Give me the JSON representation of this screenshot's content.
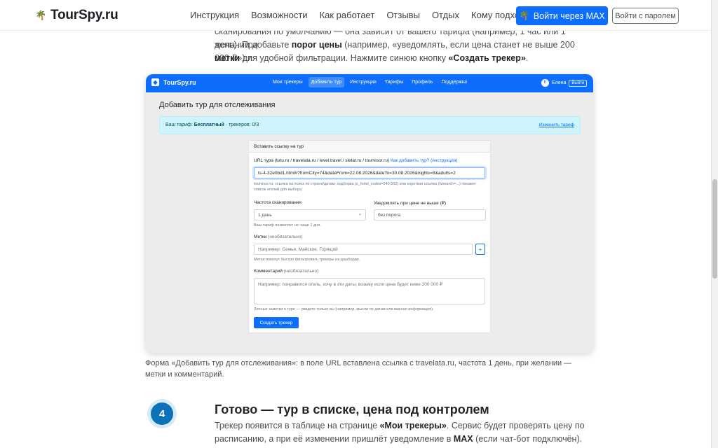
{
  "site": {
    "logo_icon": "palm-tree-icon",
    "logo_text": "TourSpy.ru",
    "nav": [
      "Инструкция",
      "Возможности",
      "Как работает",
      "Отзывы",
      "Отдых",
      "Кому подходит"
    ],
    "btn_max": "Войти через MAX",
    "btn_max_icon": "🌴",
    "btn_password": "Войти с паролем",
    "accent": "#0d6efd"
  },
  "intro": {
    "line1": "сканирования по умолчанию — она зависит от вашего тарифа (например, 1 час или 1 день). При",
    "line2_a": "желании добавьте ",
    "line2_b": "порог цены",
    "line2_c": " (например, «уведомлять, если цена станет не выше 200 000 ₽») и",
    "line3_a": "метки",
    "line3_b": " для удобной фильтрации. Нажмите синюю кнопку ",
    "line3_c": "«Создать трекер»",
    "line3_d": "."
  },
  "shot": {
    "logo_text": "TourSpy.ru",
    "nav": [
      "Мои трекеры",
      "Добавить тур",
      "Инструкция",
      "Тарифы",
      "Профиль",
      "Поддержка"
    ],
    "active_nav": 1,
    "user_initial": "Е",
    "user_name": "Елена",
    "logout": "Выйти",
    "title": "Добавить тур для отслеживания",
    "tariff_prefix": "Ваш тариф: ",
    "tariff_name": "Бесплатный",
    "tariff_suffix": " · трекеров: 0/3",
    "tariff_link": "Изменить тариф",
    "form_header": "Вставить ссылку на тур",
    "url_label": "URL тура (tutu.ru / travelata.ru / level.travel / sletat.ru / tourvisor.ru)",
    "url_help_link": "Как добавить тур? (инструкция)",
    "url_value": "ts-4-32e0bd1.html#?fromCity=74&dateFrom=22.08.2026&dateTo=30.08.2026&nights=8&adults=2",
    "url_hint": "tourvisor.ru: ссылка на поиск по стране/датам, подборка (s_hotel_codes=240,502) или короткая ссылка (tvsearch=...) покажет список отелей для выбора.",
    "freq_label": "Частота сканирования",
    "freq_value": "1 день",
    "freq_hint": "Ваш тариф позволяет не чаще 1 дня.",
    "threshold_label": "Уведомлять при цене не выше (₽)",
    "threshold_placeholder": "без порога",
    "tags_label": "Метки",
    "tags_optional": " (необязательно)",
    "tags_placeholder": "Например: Семья, Майские, Горящий",
    "tags_add": "+",
    "tags_hint": "Метки помогут быстро фильтровать трекеры на дашборде.",
    "comment_label": "Комментарий",
    "comment_optional": " (необязательно)",
    "comment_placeholder": "Например: понравился отель, хочу в эти даты, возьму если цена будет ниже 200 000 ₽",
    "comment_hint": "Личные заметки о туре — увидите только вы (например, мысли по датам или важная информация).",
    "submit": "Создать трекер"
  },
  "caption": "Форма «Добавить тур для отслеживания»: в поле URL вставлена ссылка с travelata.ru, частота 1 день, при желании — метки и комментарий.",
  "step": {
    "number": "4",
    "title": "Готово — тур в списке, цена под контролем",
    "p1_a": "Трекер появится в таблице на странице ",
    "p1_b": "«Мои трекеры»",
    "p1_c": ". Сервис будет проверять цену по",
    "p2_a": "расписанию, а при её изменении пришлёт уведомление в ",
    "p2_b": "MAX",
    "p2_c": " (если чат-бот подключён). Когда"
  }
}
